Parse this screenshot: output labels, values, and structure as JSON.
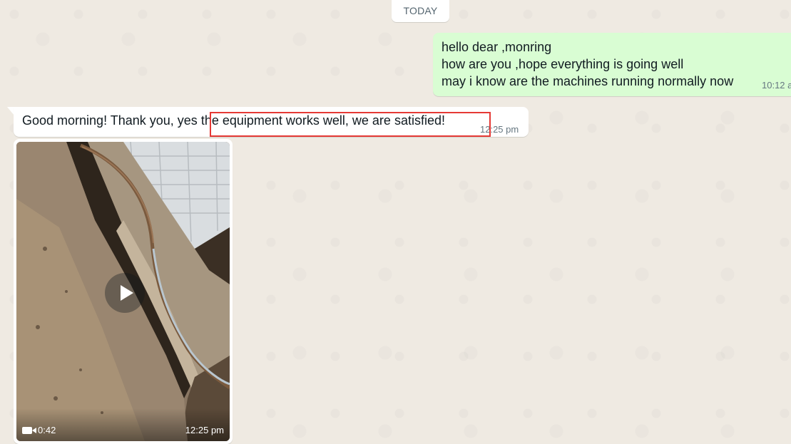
{
  "chat": {
    "date_divider": "TODAY",
    "outgoing": {
      "lines": [
        "hello dear ,monring",
        "how are you ,hope everything is going well",
        "may i know are the machines running normally now"
      ],
      "time": "10:12 a"
    },
    "incoming": {
      "text_before": "Good morning! Thank you, yes ",
      "text_highlight": "the equipment works well, we are satisfied!",
      "time": "12:25 pm"
    },
    "video": {
      "duration": "0:42",
      "time": "12:25 pm"
    }
  },
  "colors": {
    "outgoing_bubble": "#d9fdd3",
    "incoming_bubble": "#ffffff",
    "background": "#efeae2",
    "highlight_border": "#e53935"
  },
  "icons": {
    "play": "play-icon",
    "video_camera": "video-camera-icon"
  }
}
